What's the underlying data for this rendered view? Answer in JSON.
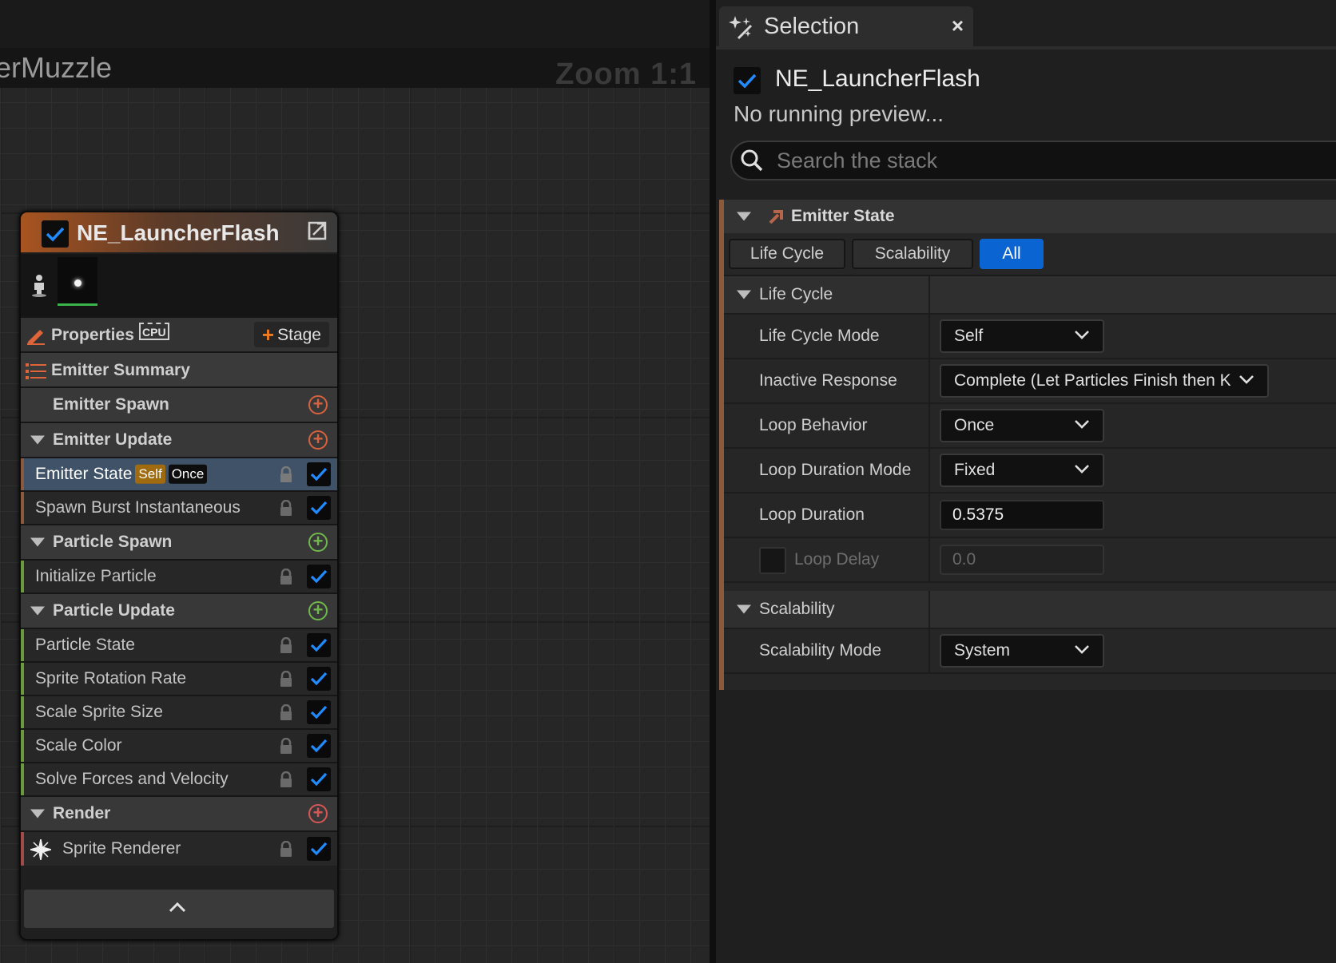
{
  "graph": {
    "title": "erMuzzle",
    "zoom": "Zoom 1:1"
  },
  "node": {
    "title": "NE_LauncherFlash",
    "properties_label": "Properties",
    "cpu_label": "CPU",
    "stage_label": "Stage",
    "summary_label": "Emitter Summary",
    "sections": [
      {
        "label": "Emitter Spawn"
      },
      {
        "label": "Emitter Update"
      },
      {
        "label": "Particle Spawn"
      },
      {
        "label": "Particle Update"
      },
      {
        "label": "Render"
      }
    ],
    "items": [
      {
        "label": "Emitter State",
        "badge1": "Self",
        "badge2": "Once"
      },
      {
        "label": "Spawn Burst Instantaneous"
      },
      {
        "label": "Initialize Particle"
      },
      {
        "label": "Particle State"
      },
      {
        "label": "Sprite Rotation Rate"
      },
      {
        "label": "Scale Sprite Size"
      },
      {
        "label": "Scale Color"
      },
      {
        "label": "Solve Forces and Velocity"
      },
      {
        "label": "Sprite Renderer"
      }
    ],
    "colors": {
      "emitter_stripe": "#8b5a3c",
      "particle_stripe": "#6a9a3c",
      "render_stripe": "#a04a4a",
      "add_emitter": "#d8623e",
      "add_particle": "#6fb84a",
      "add_render": "#d85656",
      "accent_blue": "#0a64d2"
    }
  },
  "panel": {
    "tab_title": "Selection",
    "tab_close": "×",
    "selected_name": "NE_LauncherFlash",
    "preview_status": "No running preview...",
    "search_placeholder": "Search the stack",
    "section_title": "Emitter State",
    "filters": [
      "Life Cycle",
      "Scalability",
      "All"
    ],
    "active_filter": "All",
    "lifecycle_category": "Life Cycle",
    "props": {
      "life_cycle_mode": {
        "label": "Life Cycle Mode",
        "value": "Self"
      },
      "inactive_response": {
        "label": "Inactive Response",
        "value": "Complete (Let Particles Finish then Kill"
      },
      "loop_behavior": {
        "label": "Loop Behavior",
        "value": "Once"
      },
      "loop_duration_mode": {
        "label": "Loop Duration Mode",
        "value": "Fixed"
      },
      "loop_duration": {
        "label": "Loop Duration",
        "value": "0.5375"
      },
      "loop_delay": {
        "label": "Loop Delay",
        "value": "0.0"
      }
    },
    "scalability_category": "Scalability",
    "scalability_mode": {
      "label": "Scalability Mode",
      "value": "System"
    }
  }
}
